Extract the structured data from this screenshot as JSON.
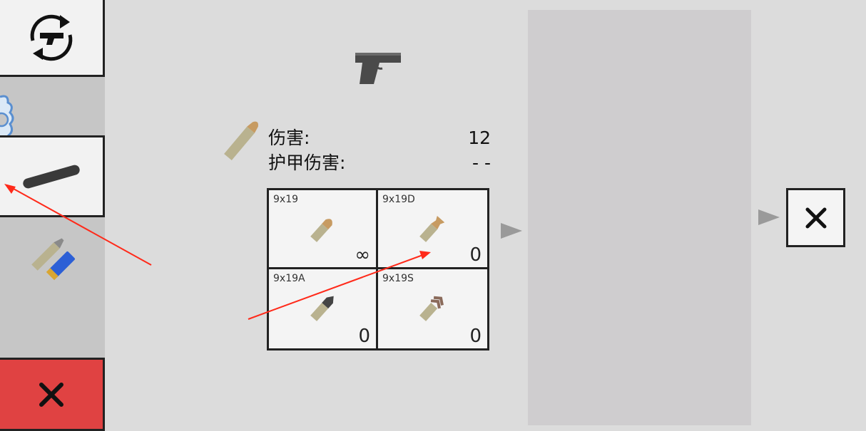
{
  "sidebar": {
    "swap_weapon": {
      "icon": "swap-weapon-icon"
    },
    "gear": {
      "icon": "gear-icon"
    },
    "silencer": {
      "icon": "silencer-icon"
    },
    "ammo": {
      "icon": "ammo-icon"
    },
    "close": {
      "icon": "close-icon"
    }
  },
  "weapon": {
    "icon": "pistol-icon"
  },
  "bullet": {
    "icon": "bullet-icon"
  },
  "stats": {
    "damage_label": "伤害:",
    "damage_value": "12",
    "armor_damage_label": "护甲伤害:",
    "armor_damage_value": "- -"
  },
  "ammo_types": [
    {
      "name": "9x19",
      "count": "∞"
    },
    {
      "name": "9x19D",
      "count": "0"
    },
    {
      "name": "9x19A",
      "count": "0"
    },
    {
      "name": "9x19S",
      "count": "0"
    }
  ],
  "colors": {
    "background": "#dcdcdc",
    "panel": "#cfcdcf",
    "close_red": "#e04242",
    "annotation": "#ff2a1a"
  }
}
